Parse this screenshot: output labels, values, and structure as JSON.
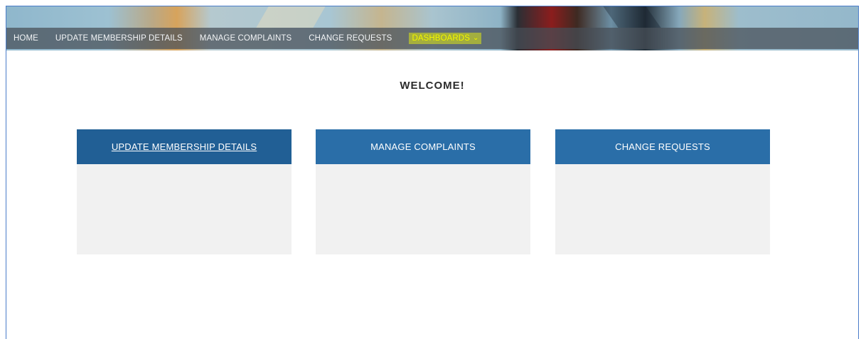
{
  "nav": {
    "items": [
      {
        "label": "HOME"
      },
      {
        "label": "UPDATE MEMBERSHIP DETAILS"
      },
      {
        "label": "MANAGE COMPLAINTS"
      },
      {
        "label": "CHANGE REQUESTS"
      },
      {
        "label": "DASHBOARDS"
      }
    ],
    "dropdown_icon": "chevron-down-icon",
    "highlight_color": "#f4f80a"
  },
  "main": {
    "welcome": "WELCOME!",
    "cards": [
      {
        "title": "UPDATE MEMBERSHIP DETAILS"
      },
      {
        "title": "MANAGE COMPLAINTS"
      },
      {
        "title": "CHANGE REQUESTS"
      }
    ]
  },
  "colors": {
    "card_header": "#2a6ea8",
    "card_header_active": "#215f95",
    "card_body": "#f1f1f1"
  }
}
